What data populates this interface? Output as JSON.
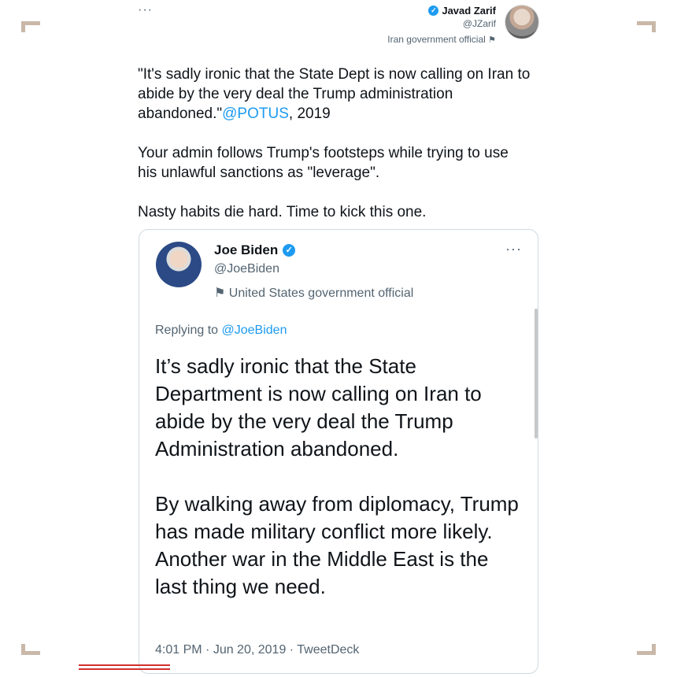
{
  "outer_tweet": {
    "more_icon": "more-horizontal-icon",
    "author": {
      "name": "Javad Zarif",
      "handle": "@JZarif",
      "label": "Iran government official",
      "verified": true,
      "avatar_icon": "avatar-photo"
    },
    "text": {
      "p1_pre": "\"It's sadly ironic that the State Dept is now calling on Iran to abide by the very deal the Trump administration abandoned.\"",
      "p1_mention": "@POTUS",
      "p1_post": ", 2019",
      "p2": "Your admin follows Trump's footsteps while trying to use his unlawful sanctions as \"leverage\".",
      "p3": "Nasty habits die hard. Time to kick this one."
    }
  },
  "quoted_tweet": {
    "author": {
      "name": "Joe Biden",
      "handle": "@JoeBiden",
      "label": "United States government official",
      "verified": true
    },
    "replying_to_prefix": "Replying to ",
    "replying_to_handle": "@JoeBiden",
    "body_p1": "It’s sadly ironic that the State Department is now calling on Iran to abide by the very deal the Trump Administration abandoned.",
    "body_p2": "By walking away from diplomacy, Trump has made military conflict more likely. Another war in the Middle East is the last thing we need.",
    "time": "4:01 PM",
    "date": "Jun 20, 2019",
    "source": "TweetDeck",
    "separator": " · "
  },
  "colors": {
    "accent": "#1d9bf0",
    "annotation": "#d32f2f",
    "text_secondary": "#536471"
  }
}
